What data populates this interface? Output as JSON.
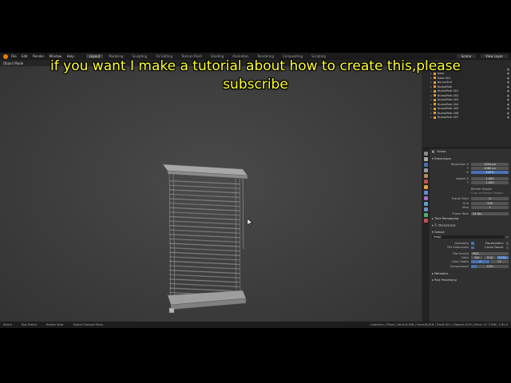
{
  "topbar": {
    "menus": [
      "File",
      "Edit",
      "Render",
      "Window",
      "Help"
    ],
    "tabs": [
      "Layout",
      "Modeling",
      "Sculpting",
      "UV Editing",
      "Texture Paint",
      "Shading",
      "Animation",
      "Rendering",
      "Compositing",
      "Scripting"
    ],
    "active_tab": "Layout",
    "scene_label": "Scene",
    "view_layer_label": "View Layer"
  },
  "viewport": {
    "mode_label": "Object Mode"
  },
  "outliner": {
    "root": "Collection",
    "rows": [
      {
        "label": "Empty"
      },
      {
        "label": "base"
      },
      {
        "label": "base.001"
      },
      {
        "label": "bo.control"
      },
      {
        "label": "NurbsPath"
      },
      {
        "label": "NurbsPath.001"
      },
      {
        "label": "NurbsPath.002"
      },
      {
        "label": "NurbsPath.003"
      },
      {
        "label": "NurbsPath.004"
      },
      {
        "label": "NurbsPath.005"
      },
      {
        "label": "NurbsPath.006"
      },
      {
        "label": "NurbsPath.007"
      }
    ]
  },
  "properties": {
    "header": "Scene",
    "dimensions_label": "Dimensions",
    "resolution_x_label": "Resolution X",
    "resolution_x": "1920 px",
    "resolution_y_label": "Y",
    "resolution_y": "1080 px",
    "percent_label": "%",
    "percent": "100%",
    "aspect_x_label": "Aspect X",
    "aspect_x": "1.000",
    "aspect_y_label": "Y",
    "aspect_y": "1.000",
    "render_region": "Render Region",
    "crop_region": "Crop to Render Region",
    "frame_start_label": "Frame Start",
    "frame_start": "0",
    "end_label": "End",
    "end": "250",
    "step_label": "Step",
    "step": "1",
    "frame_rate_label": "Frame Rate",
    "frame_rate": "24 fps",
    "time_remapping": "Time Remapping",
    "stereoscopy": "Stereoscopy",
    "output_label": "Output",
    "output_path": "/tmp/",
    "overwrite": "Overwrite",
    "placeholders": "Placeholders",
    "file_extensions": "File Extensions",
    "cache_result": "Cache Result",
    "file_format_label": "File Format",
    "file_format": "PNG",
    "color_label": "Color",
    "color_options": [
      "BW",
      "RGB",
      "RGBA"
    ],
    "color_active": "RGBA",
    "color_depth_label": "Color Depth",
    "color_depth_options": [
      "8",
      "16"
    ],
    "color_depth_active": "8",
    "compression_label": "Compression",
    "compression": "15%",
    "metadata": "Metadata",
    "post_processing": "Post Processing"
  },
  "statusbar": {
    "select": "Select",
    "box_select": "Box Select",
    "rotate_view": "Rotate View",
    "context_menu": "Object Context Menu",
    "stats": "Collection | Plane | Verts:8,998 | Faces:8,818 | Tris:8,501 | Objects:0/19 | Mem: 57.7 MiB | 2.82.0"
  },
  "caption": {
    "line1": "if you want I make a tutorial about how to create this,please",
    "line2": "subscribe"
  },
  "colors": {
    "caption": "#ffff33",
    "accent": "#4772b3",
    "logo": "#e87d0d"
  }
}
